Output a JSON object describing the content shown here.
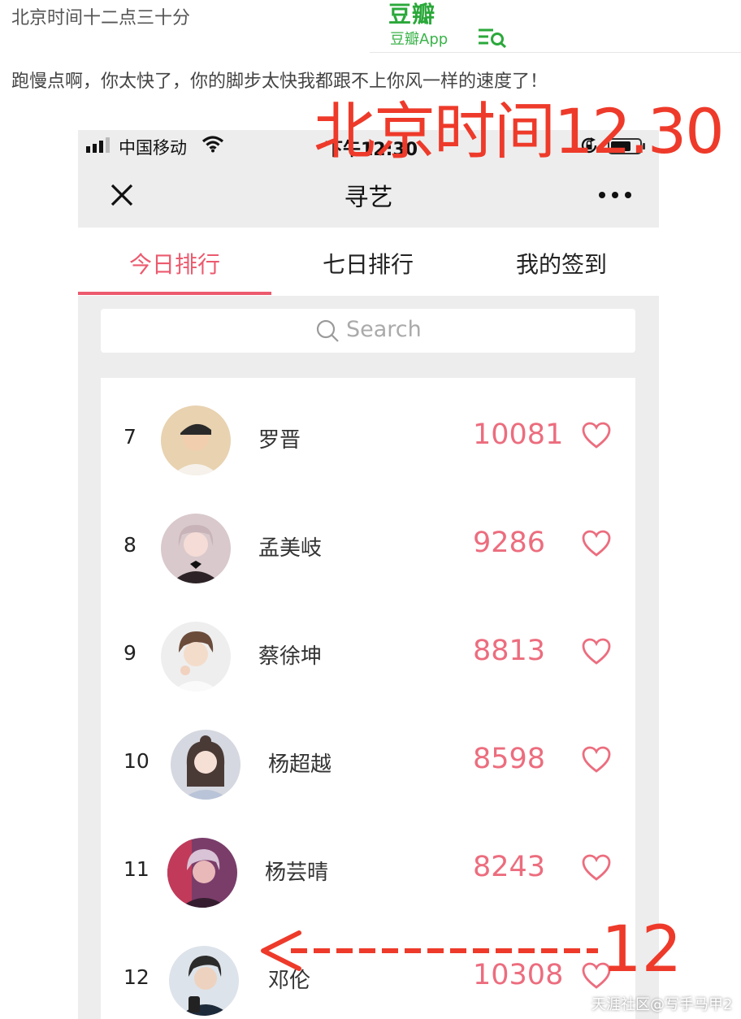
{
  "post": {
    "title": "北京时间十二点三十分",
    "body": "跑慢点啊，你太快了，你的脚步太快我都跟不上你风一样的速度了！"
  },
  "douban": {
    "logo": "豆瓣",
    "app_label": "豆瓣App",
    "menu_icon": "menu-search-icon",
    "brand_color": "#2aa83a"
  },
  "phone": {
    "status": {
      "carrier": "中国移动",
      "time": "下午12:30"
    },
    "nav": {
      "title": "寻艺"
    },
    "tabs": [
      {
        "label": "今日排行",
        "active": true
      },
      {
        "label": "七日排行",
        "active": false
      },
      {
        "label": "我的签到",
        "active": false
      }
    ],
    "search": {
      "placeholder": "Search"
    },
    "rankings": [
      {
        "rank": "7",
        "name": "罗晋",
        "score": "10081"
      },
      {
        "rank": "8",
        "name": "孟美岐",
        "score": "9286"
      },
      {
        "rank": "9",
        "name": "蔡徐坤",
        "score": "8813"
      },
      {
        "rank": "10",
        "name": "杨超越",
        "score": "8598"
      },
      {
        "rank": "11",
        "name": "杨芸晴",
        "score": "8243"
      },
      {
        "rank": "12",
        "name": "邓伦",
        "score": "10308"
      }
    ],
    "accent_color": "#ec5a6e"
  },
  "annotations": {
    "headline": "北京时间12.30",
    "rank_marker": "12",
    "color": "#ee3a2a"
  },
  "watermark": "天涯社区@写手马甲2"
}
